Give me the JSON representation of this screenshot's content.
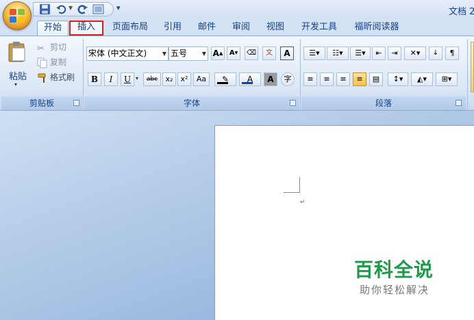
{
  "window": {
    "title": "文档 2"
  },
  "tabs": [
    {
      "label": "开始"
    },
    {
      "label": "插入"
    },
    {
      "label": "页面布局"
    },
    {
      "label": "引用"
    },
    {
      "label": "邮件"
    },
    {
      "label": "审阅"
    },
    {
      "label": "视图"
    },
    {
      "label": "开发工具"
    },
    {
      "label": "福昕阅读器"
    }
  ],
  "clipboard": {
    "paste": "粘贴",
    "cut": "剪切",
    "copy": "复制",
    "format_painter": "格式刷",
    "group": "剪贴板"
  },
  "font": {
    "name": "宋体 (中文正文)",
    "size": "五号",
    "group": "字体",
    "bold": "B",
    "italic": "I",
    "underline": "U",
    "strike": "abc",
    "subscript": "x₂",
    "superscript": "x²",
    "case": "Aa"
  },
  "paragraph": {
    "group": "段落"
  },
  "watermark": {
    "title": "百科全说",
    "subtitle": "助你轻松解决"
  },
  "colors": {
    "highlight_border": "#d9231b",
    "watermark": "#1f9a4b"
  }
}
